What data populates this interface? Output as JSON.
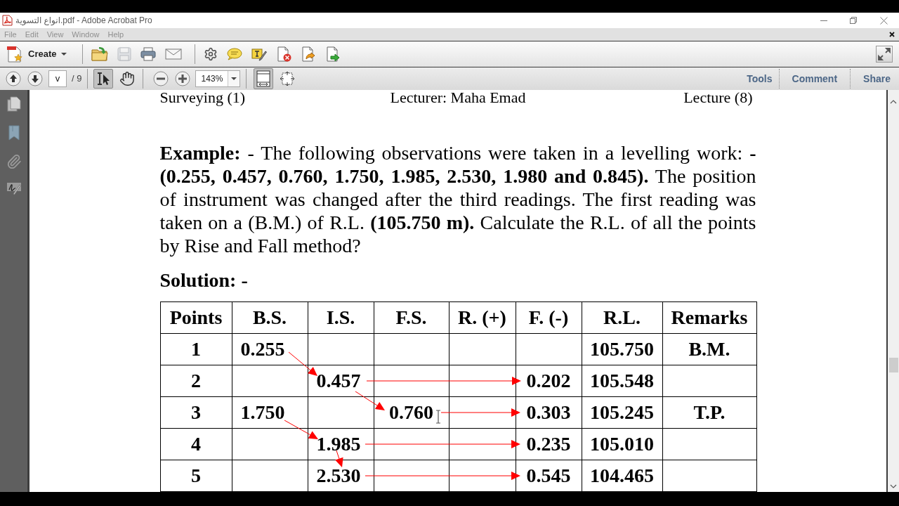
{
  "window": {
    "title": "انواع التسوية.pdf - Adobe Acrobat Pro"
  },
  "menu": [
    {
      "label": "File",
      "disabled": true
    },
    {
      "label": "Edit",
      "disabled": true
    },
    {
      "label": "View",
      "disabled": true
    },
    {
      "label": "Window",
      "disabled": true
    },
    {
      "label": "Help",
      "disabled": true
    }
  ],
  "toolbar": {
    "create": "Create",
    "groups": [
      [
        {
          "kind": "open",
          "disabled": false
        },
        {
          "kind": "save",
          "disabled": true
        },
        {
          "kind": "print",
          "disabled": false
        },
        {
          "kind": "email",
          "disabled": false
        }
      ],
      [
        {
          "kind": "settings",
          "disabled": false
        },
        {
          "kind": "comment",
          "disabled": false
        },
        {
          "kind": "fill-sign",
          "disabled": false
        },
        {
          "kind": "delete",
          "disabled": false
        },
        {
          "kind": "export",
          "disabled": false
        },
        {
          "kind": "send",
          "disabled": false
        }
      ]
    ]
  },
  "navigation": {
    "page": "v",
    "page_count": "/ 9",
    "tools": [
      {
        "kind": "select",
        "selected": true
      },
      {
        "kind": "hand",
        "selected": false
      }
    ],
    "zoom": "143%",
    "views": [
      {
        "kind": "fit-page",
        "selected": true
      },
      {
        "kind": "scrolling",
        "selected": false
      }
    ]
  },
  "panes": [
    {
      "label": "Tools"
    },
    {
      "label": "Comment"
    },
    {
      "label": "Share"
    }
  ],
  "document": {
    "header": [
      "Surveying (1)",
      "Lecturer: Maha Emad",
      "Lecture (8)"
    ],
    "problem": "**Example:** - The following observations were taken in a levelling work: **- (0.255, 0.457, 0.760, 1.750, 1.985, 2.530, 1.980 and 0.845).** The position of instrument was changed after the third readings. The first reading was taken on a (B.M.) of R.L. **(105.750 m).** Calculate the R.L. of all the points by Rise and Fall method?",
    "solution_label": "Solution: -",
    "table": {
      "columns": [
        "Points",
        "B.S.",
        "I.S.",
        "F.S.",
        "R. (+)",
        "F. (-)",
        "R.L.",
        "Remarks"
      ],
      "rows": [
        {
          "points": "1",
          "bs": "0.255",
          "rl": "105.750",
          "remarks": "B.M."
        },
        {
          "points": "2",
          "is": "0.457",
          "fall": "0.202",
          "rl": "105.548"
        },
        {
          "points": "3",
          "bs": "1.750",
          "fs": "0.760",
          "fall": "0.303",
          "rl": "105.245",
          "remarks": "T.P."
        },
        {
          "points": "4",
          "is": "1.985",
          "fall": "0.235",
          "rl": "105.010"
        },
        {
          "points": "5",
          "is": "2.530",
          "fall": "0.545",
          "rl": "104.465"
        }
      ]
    }
  }
}
